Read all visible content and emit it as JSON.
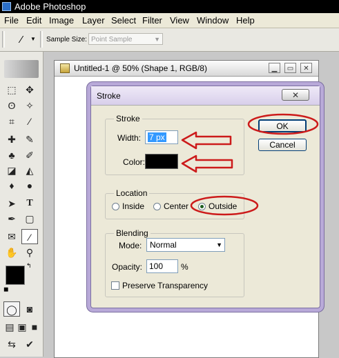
{
  "app": {
    "title": "Adobe Photoshop"
  },
  "menu": [
    "File",
    "Edit",
    "Image",
    "Layer",
    "Select",
    "Filter",
    "View",
    "Window",
    "Help"
  ],
  "options_bar": {
    "sample_size_label": "Sample Size:",
    "sample_size_value": "Point Sample"
  },
  "document": {
    "title": "Untitled-1 @ 50% (Shape 1, RGB/8)"
  },
  "dialog": {
    "title": "Stroke",
    "stroke_group": "Stroke",
    "width_label": "Width:",
    "width_value": "7 px",
    "color_label": "Color:",
    "color_value": "#000000",
    "location_group": "Location",
    "location_options": [
      "Inside",
      "Center",
      "Outside"
    ],
    "location_selected": "Outside",
    "blending_group": "Blending",
    "mode_label": "Mode:",
    "mode_value": "Normal",
    "opacity_label": "Opacity:",
    "opacity_value": "100",
    "opacity_unit": "%",
    "preserve_label": "Preserve Transparency",
    "preserve_checked": false,
    "ok_label": "OK",
    "cancel_label": "Cancel"
  },
  "annotation_color": "#cc1a1a",
  "accent_color": "#3399ff"
}
